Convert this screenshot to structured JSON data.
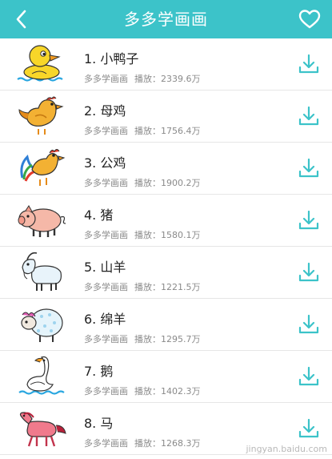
{
  "header": {
    "title": "多多学画画",
    "back_icon": "chevron-left-icon",
    "favorite_icon": "heart-icon"
  },
  "accent_color": "#3cc3c9",
  "items": [
    {
      "index": "1.",
      "name": "小鸭子",
      "source": "多多学画画",
      "plays_label": "播放：",
      "plays": "2339.6万",
      "icon": "duck-icon"
    },
    {
      "index": "2.",
      "name": "母鸡",
      "source": "多多学画画",
      "plays_label": "播放：",
      "plays": "1756.4万",
      "icon": "hen-icon"
    },
    {
      "index": "3.",
      "name": "公鸡",
      "source": "多多学画画",
      "plays_label": "播放：",
      "plays": "1900.2万",
      "icon": "rooster-icon"
    },
    {
      "index": "4.",
      "name": "猪",
      "source": "多多学画画",
      "plays_label": "播放：",
      "plays": "1580.1万",
      "icon": "pig-icon"
    },
    {
      "index": "5.",
      "name": "山羊",
      "source": "多多学画画",
      "plays_label": "播放：",
      "plays": "1221.5万",
      "icon": "goat-icon"
    },
    {
      "index": "6.",
      "name": "绵羊",
      "source": "多多学画画",
      "plays_label": "播放：",
      "plays": "1295.7万",
      "icon": "sheep-icon"
    },
    {
      "index": "7.",
      "name": "鹅",
      "source": "多多学画画",
      "plays_label": "播放：",
      "plays": "1402.3万",
      "icon": "goose-icon"
    },
    {
      "index": "8.",
      "name": "马",
      "source": "多多学画画",
      "plays_label": "播放：",
      "plays": "1268.3万",
      "icon": "horse-icon"
    }
  ],
  "watermark": "jingyan.baidu.com"
}
